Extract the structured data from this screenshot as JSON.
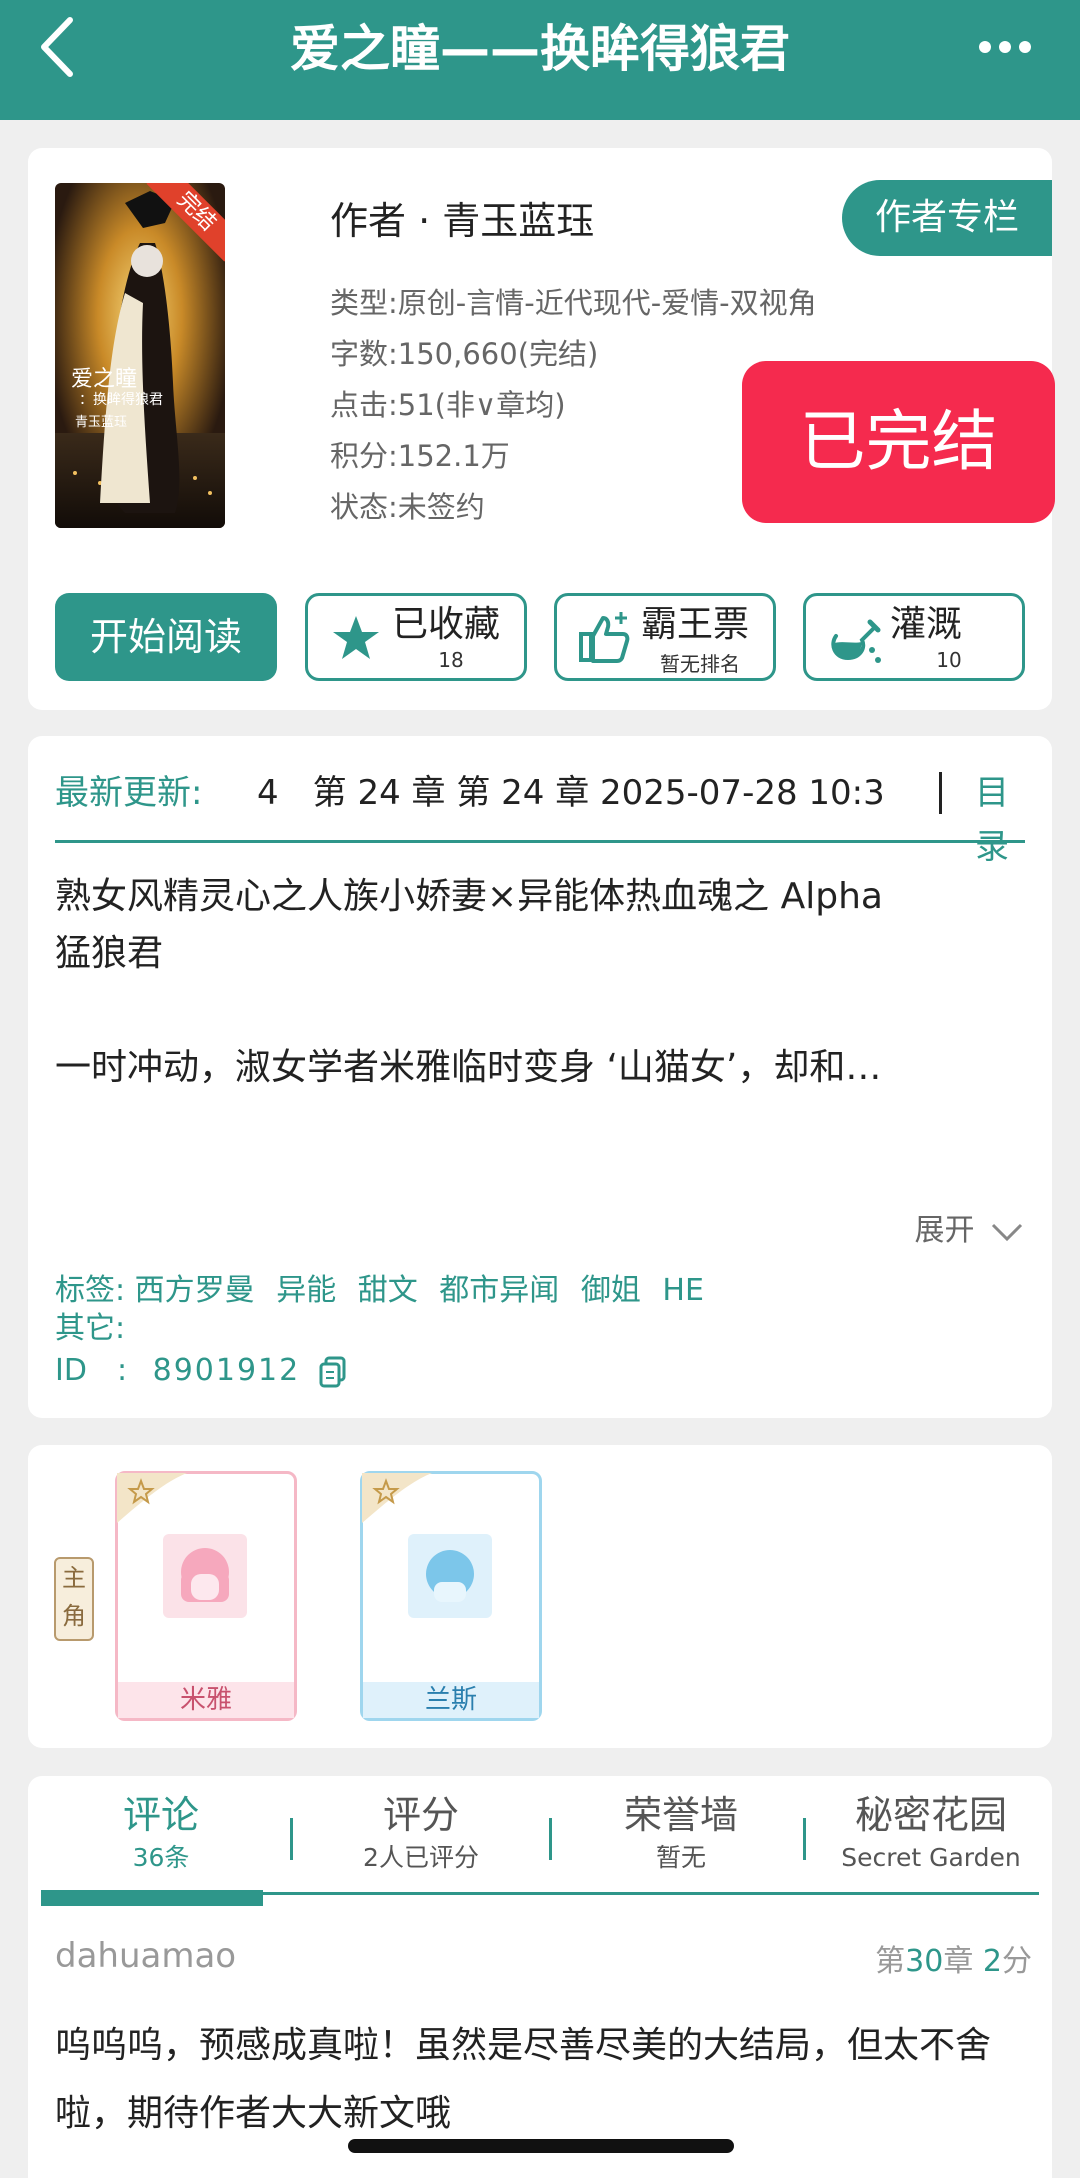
{
  "header": {
    "title": "爱之瞳——换眸得狼君"
  },
  "book": {
    "author_line": "作者 · 青玉蓝珏",
    "author_column_label": "作者专栏",
    "cover_badge": "完结",
    "cover_title": "爱之瞳",
    "cover_subtitle": "：换眸得狼君",
    "cover_author": "青玉蓝珏",
    "meta": [
      "类型:原创-言情-近代现代-爱情-双视角",
      "字数:150,660(完结)",
      "点击:51(非∨章均)",
      "积分:152.1万",
      "状态:未签约"
    ],
    "status_stamp": "已完结"
  },
  "actions": {
    "read_label": "开始阅读",
    "collect_label": "已收藏",
    "collect_count": "18",
    "ticket_label": "霸王票",
    "ticket_sub": "暂无排名",
    "water_label": "灌溉",
    "water_count": "10"
  },
  "info": {
    "update_label": "最新更新:",
    "update_text": "4　第 24 章 第 24 章 2025-07-28 10:3",
    "toc_label": "目录",
    "intro_line1": "熟女风精灵心之人族小娇妻×异能体热血魂之 Alpha",
    "intro_line2": "猛狼君",
    "intro_line3": "一时冲动，淑女学者米雅临时变身 ‘山猫女’，却和…",
    "expand_label": "展开",
    "tags_label": "标签:",
    "tags": [
      "西方罗曼",
      "异能",
      "甜文",
      "都市异闻",
      "御姐",
      "HE"
    ],
    "other_label": "其它:",
    "id_label": "ID　:",
    "id_value": "8901912"
  },
  "characters": {
    "role_label_1": "主",
    "role_label_2": "角",
    "list": [
      {
        "name": "米雅"
      },
      {
        "name": "兰斯"
      }
    ]
  },
  "comments": {
    "tabs": [
      {
        "title": "评论",
        "sub": "36条"
      },
      {
        "title": "评分",
        "sub": "2人已评分"
      },
      {
        "title": "荣誉墙",
        "sub": "暂无"
      },
      {
        "title": "秘密花园",
        "sub": "Secret Garden"
      }
    ],
    "first": {
      "user": "dahuamao",
      "chapter_prefix": "第",
      "chapter": "30",
      "chapter_suffix": "章",
      "score": "2",
      "score_suffix": "分",
      "text": "呜呜呜，预感成真啦！虽然是尽善尽美的大结局，但太不舍啦，期待作者大大新文哦"
    }
  },
  "colors": {
    "accent": "#2e968a",
    "stamp": "#f52a4e"
  }
}
